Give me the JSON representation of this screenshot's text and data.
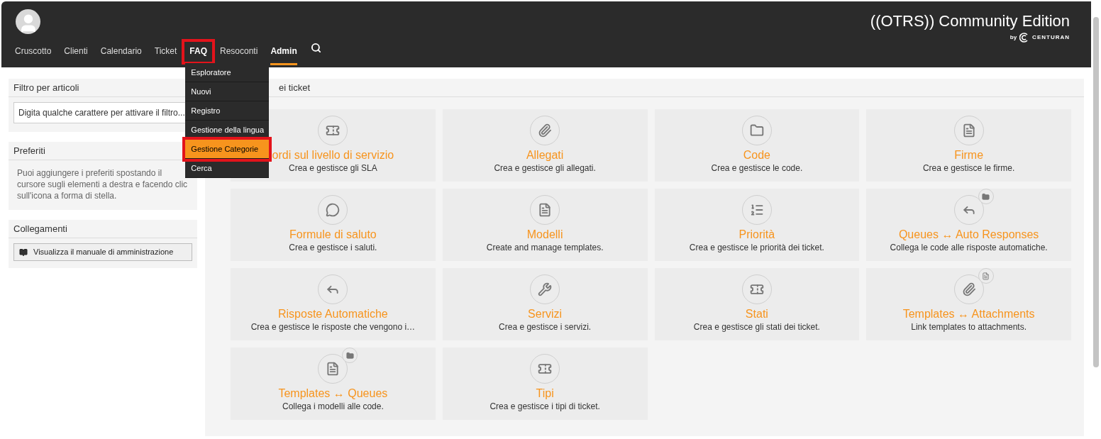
{
  "brand": {
    "title": "((OTRS)) Community Edition",
    "byline": "by",
    "company": "CENTURAN"
  },
  "nav": [
    {
      "label": "Cruscotto",
      "selected": false,
      "highlighted": false
    },
    {
      "label": "Clienti",
      "selected": false,
      "highlighted": false
    },
    {
      "label": "Calendario",
      "selected": false,
      "highlighted": false
    },
    {
      "label": "Ticket",
      "selected": false,
      "highlighted": false
    },
    {
      "label": "FAQ",
      "selected": true,
      "highlighted": true,
      "expanded": true
    },
    {
      "label": "Resoconti",
      "selected": false,
      "highlighted": false
    },
    {
      "label": "Admin",
      "selected": true,
      "highlighted": false
    }
  ],
  "dropdown": [
    {
      "label": "Esploratore",
      "selected": false,
      "highlighted": false
    },
    {
      "label": "Nuovi",
      "selected": false,
      "highlighted": false
    },
    {
      "label": "Registro",
      "selected": false,
      "highlighted": false
    },
    {
      "label": "Gestione della lingua",
      "selected": false,
      "highlighted": false
    },
    {
      "label": "Gestione Categorie",
      "selected": true,
      "highlighted": true
    },
    {
      "label": "Cerca",
      "selected": false,
      "highlighted": false
    }
  ],
  "sidebar": {
    "filter": {
      "title": "Filtro per articoli",
      "placeholder": "Digita qualche carattere per attivare il filtro..."
    },
    "favorites": {
      "title": "Preferiti",
      "text": "Puoi aggiungere i preferiti spostando il cursore sugli elementi a destra e facendo clic sull'icona a forma di stella."
    },
    "links": {
      "title": "Collegamenti",
      "button": "Visualizza il manuale di amministrazione"
    }
  },
  "panel": {
    "title": "ei ticket",
    "cards": [
      {
        "title": "ordi sul livello di servizio",
        "description": "Crea e gestisce gli SLA"
      },
      {
        "title": "Allegati",
        "description": "Crea e gestisce gli allegati."
      },
      {
        "title": "Code",
        "description": "Crea e gestisce le code."
      },
      {
        "title": "Firme",
        "description": "Crea e gestisce le firme."
      },
      {
        "title": "Formule di saluto",
        "description": "Crea e gestisce i saluti."
      },
      {
        "title": "Modelli",
        "description": "Create and manage templates."
      },
      {
        "title": "Priorità",
        "description": "Crea e gestisce le priorità dei ticket."
      },
      {
        "title": "Queues ↔ Auto Responses",
        "description": "Collega le code alle risposte automatiche."
      },
      {
        "title": "Risposte Automatiche",
        "description": "Crea e gestisce le risposte che vengono i…"
      },
      {
        "title": "Servizi",
        "description": "Crea e gestisce i servizi."
      },
      {
        "title": "Stati",
        "description": "Crea e gestisce gli stati dei ticket."
      },
      {
        "title": "Templates ↔ Attachments",
        "description": "Link templates to attachments."
      },
      {
        "title": "Templates ↔ Queues",
        "description": "Collega i modelli alle code."
      },
      {
        "title": "Tipi",
        "description": "Crea e gestisce i tipi di ticket."
      }
    ]
  }
}
